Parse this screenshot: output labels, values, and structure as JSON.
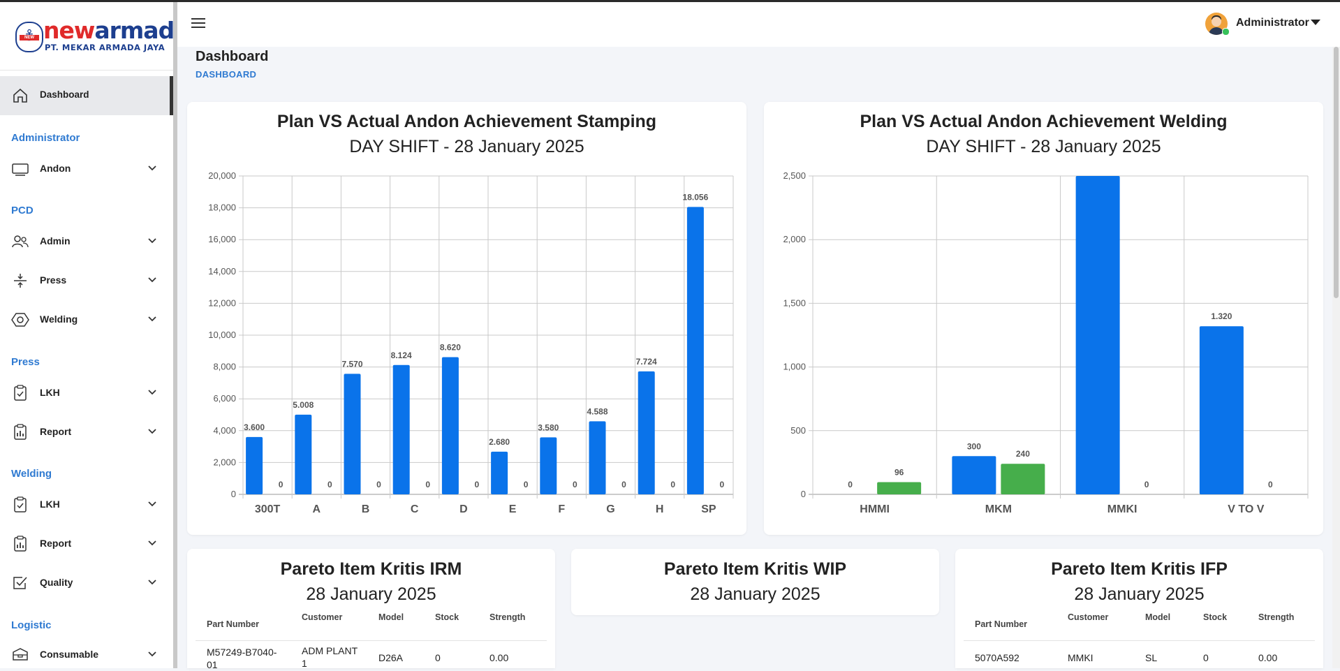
{
  "brand": {
    "name_part1": "new",
    "name_part2": "armada",
    "subtitle": "PT. MEKAR ARMADA JAYA",
    "emblem_text": "NEW",
    "accent_red": "#e02a2a",
    "accent_blue": "#1d3f8f"
  },
  "header": {
    "user": "Administrator",
    "menu_icon": "hamburger-icon"
  },
  "page": {
    "title": "Dashboard",
    "breadcrumb": "DASHBOARD"
  },
  "sidebar": {
    "active": {
      "label": "Dashboard",
      "icon": "home-icon"
    },
    "sections": [
      {
        "title": "Administrator",
        "items": [
          {
            "label": "Andon",
            "icon": "monitor-icon"
          }
        ]
      },
      {
        "title": "PCD",
        "items": [
          {
            "label": "Admin",
            "icon": "users-icon"
          },
          {
            "label": "Press",
            "icon": "press-icon"
          },
          {
            "label": "Welding",
            "icon": "hexagon-icon"
          }
        ]
      },
      {
        "title": "Press",
        "items": [
          {
            "label": "LKH",
            "icon": "clipboard-check-icon"
          },
          {
            "label": "Report",
            "icon": "report-chart-icon"
          }
        ]
      },
      {
        "title": "Welding",
        "items": [
          {
            "label": "LKH",
            "icon": "clipboard-check-icon"
          },
          {
            "label": "Report",
            "icon": "report-chart-icon"
          },
          {
            "label": "Quality",
            "icon": "checkbox-icon"
          }
        ]
      },
      {
        "title": "Logistic",
        "items": [
          {
            "label": "Consumable",
            "icon": "box-icon"
          }
        ]
      }
    ]
  },
  "stamping": {
    "title": "Plan VS Actual Andon Achievement Stamping",
    "subtitle": "DAY SHIFT - 28 January 2025"
  },
  "welding": {
    "title": "Plan VS Actual Andon Achievement Welding",
    "subtitle": "DAY SHIFT - 28 January 2025"
  },
  "chart_data": [
    {
      "type": "bar",
      "title": "Plan VS Actual Andon Achievement Stamping",
      "subtitle": "DAY SHIFT - 28 January 2025",
      "categories": [
        "300T",
        "A",
        "B",
        "C",
        "D",
        "E",
        "F",
        "G",
        "H",
        "SP"
      ],
      "series": [
        {
          "color": "#0a73ea",
          "values": [
            3600,
            5008,
            7570,
            8124,
            8620,
            2680,
            3580,
            4588,
            7724,
            18056
          ],
          "labels": [
            "3.600",
            "5.008",
            "7.570",
            "8.124",
            "8.620",
            "2.680",
            "3.580",
            "4.588",
            "7.724",
            "18.056"
          ]
        },
        {
          "color": "#46ae4b",
          "values": [
            0,
            0,
            0,
            0,
            0,
            0,
            0,
            0,
            0,
            0
          ],
          "labels": [
            "0",
            "0",
            "0",
            "0",
            "0",
            "0",
            "0",
            "0",
            "0",
            "0"
          ]
        }
      ],
      "ylim": [
        0,
        20000
      ],
      "yticks": [
        "0",
        "2,000",
        "4,000",
        "6,000",
        "8,000",
        "10,000",
        "12,000",
        "14,000",
        "16,000",
        "18,000",
        "20,000"
      ],
      "grid": true
    },
    {
      "type": "bar",
      "title": "Plan VS Actual Andon Achievement Welding",
      "subtitle": "DAY SHIFT - 28 January 2025",
      "categories": [
        "HMMI",
        "MKM",
        "MMKI",
        "V TO V"
      ],
      "series": [
        {
          "color": "#0a73ea",
          "values": [
            0,
            300,
            2500,
            1320
          ],
          "labels": [
            "0",
            "300",
            "",
            "1.320"
          ]
        },
        {
          "color": "#46ae4b",
          "values": [
            96,
            240,
            0,
            0
          ],
          "labels": [
            "96",
            "240",
            "0",
            "0"
          ]
        }
      ],
      "ylim": [
        0,
        2500
      ],
      "yticks": [
        "0",
        "500",
        "1,000",
        "1,500",
        "2,000",
        "2,500"
      ],
      "grid": true
    }
  ],
  "pareto_irm": {
    "title": "Pareto Item Kritis IRM",
    "subtitle": "28 January 2025",
    "columns": [
      "Part Number",
      "Customer",
      "Model",
      "Stock",
      "Strength"
    ],
    "rows": [
      [
        "M57249-B7040-01",
        "ADM PLANT 1",
        "D26A",
        "0",
        "0.00"
      ]
    ]
  },
  "pareto_wip": {
    "title": "Pareto Item Kritis WIP",
    "subtitle": "28 January 2025"
  },
  "pareto_ifp": {
    "title": "Pareto Item Kritis IFP",
    "subtitle": "28 January 2025",
    "columns": [
      "Part Number",
      "Customer",
      "Model",
      "Stock",
      "Strength"
    ],
    "rows": [
      [
        "5070A592",
        "MMKI",
        "SL",
        "0",
        "0.00"
      ]
    ]
  }
}
